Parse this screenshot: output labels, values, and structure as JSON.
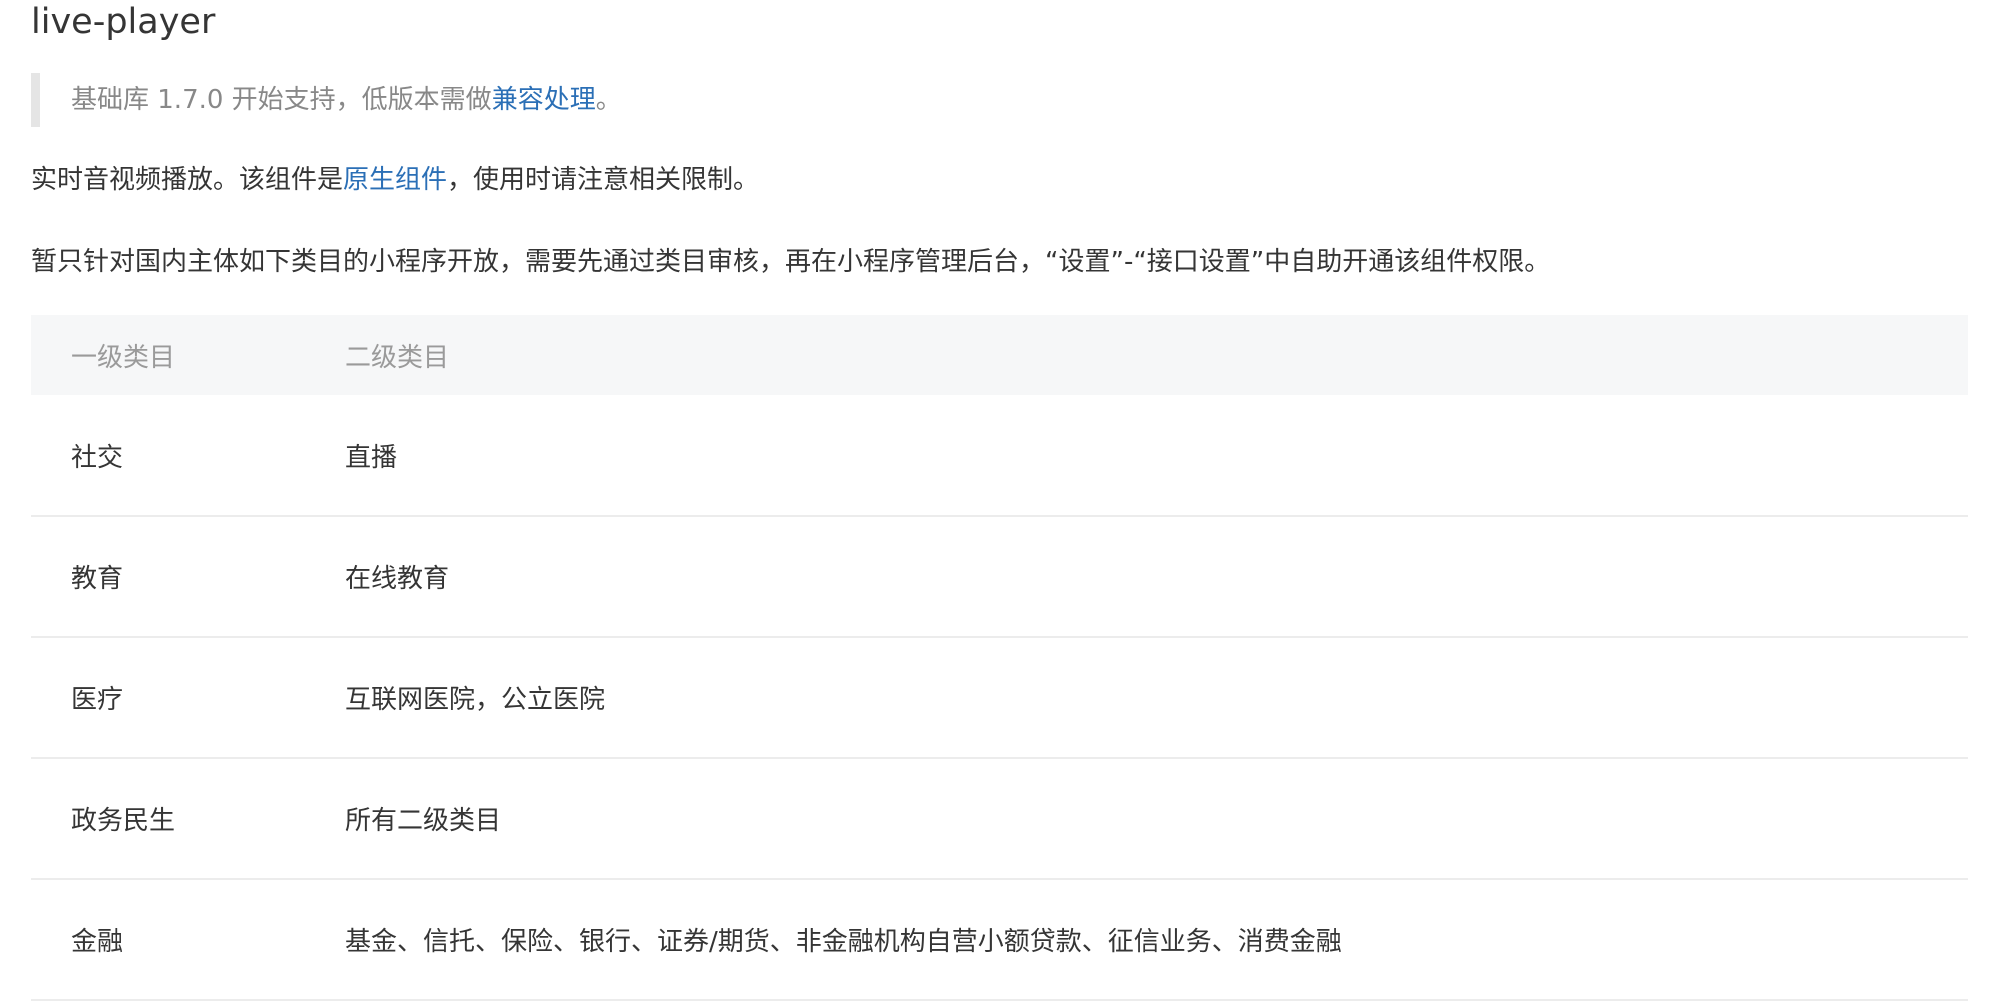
{
  "title": "live-player",
  "note": {
    "prefix": "基础库 1.7.0 开始支持，低版本需做",
    "link": "兼容处理",
    "suffix": "。"
  },
  "para1": {
    "prefix": "实时音视频播放。该组件是",
    "link": "原生组件",
    "suffix": "，使用时请注意相关限制。"
  },
  "para2": "暂只针对国内主体如下类目的小程序开放，需要先通过类目审核，再在小程序管理后台，“设置”-“接口设置”中自助开通该组件权限。",
  "table": {
    "headers": [
      "一级类目",
      "二级类目"
    ],
    "rows": [
      {
        "primary": "社交",
        "secondary": "直播"
      },
      {
        "primary": "教育",
        "secondary": "在线教育"
      },
      {
        "primary": "医疗",
        "secondary": "互联网医院，公立医院"
      },
      {
        "primary": "政务民生",
        "secondary": "所有二级类目"
      },
      {
        "primary": "金融",
        "secondary": "基金、信托、保险、银行、证券/期货、非金融机构自营小额贷款、征信业务、消费金融"
      }
    ]
  },
  "colors": {
    "link": "#2b6fb6",
    "text": "#353535",
    "muted": "#888888",
    "header_bg": "#f6f7f8",
    "note_bar": "#e5e5e5"
  }
}
